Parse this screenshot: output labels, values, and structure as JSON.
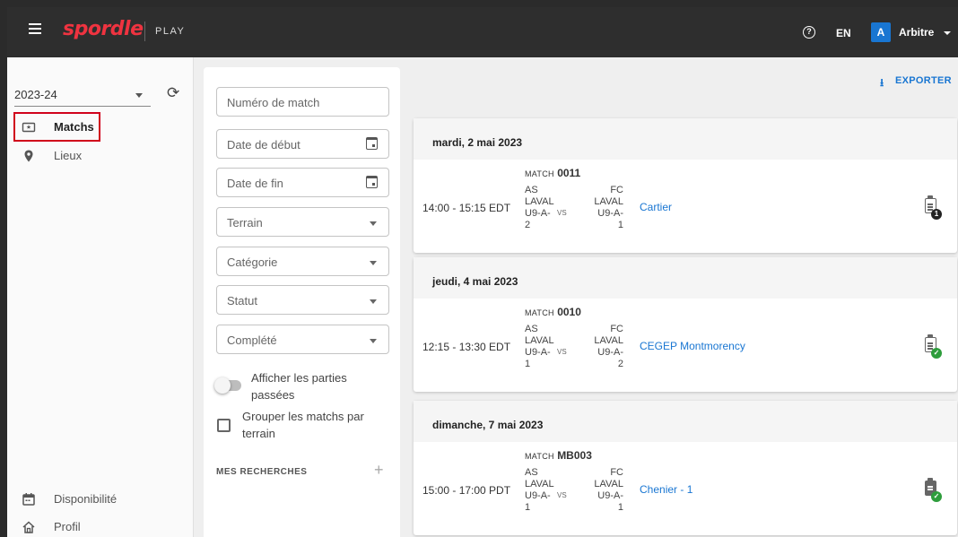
{
  "topbar": {
    "logo": "spordle",
    "product": "PLAY",
    "help_icon": "?",
    "language": "EN",
    "avatar_initial": "A",
    "user_name": "Arbitre",
    "brand_color": "#ef3340"
  },
  "sidebar": {
    "season": "2023-24",
    "items": [
      {
        "label": "Matchs",
        "icon": "ticket-icon",
        "active": true
      },
      {
        "label": "Lieux",
        "icon": "location-pin-icon"
      }
    ],
    "bottom_items": [
      {
        "label": "Disponibilité",
        "icon": "calendar-icon"
      },
      {
        "label": "Profil",
        "icon": "home-icon"
      }
    ]
  },
  "filters": {
    "match_number": "Numéro de match",
    "start_date": "Date de début",
    "end_date": "Date de fin",
    "terrain": "Terrain",
    "category": "Catégorie",
    "status": "Statut",
    "completed": "Complété",
    "show_past": "Afficher les parties passées",
    "group_by_terrain": "Grouper les matchs par terrain",
    "saved_searches": "MES RECHERCHES",
    "add_icon": "+"
  },
  "main": {
    "export_label": "EXPORTER",
    "days": [
      {
        "date": "mardi, 2 mai 2023",
        "match": {
          "time": "14:00 - 15:15 EDT",
          "prefix": "Match",
          "number": "0011",
          "home": [
            "AS",
            "LAVAL",
            "U9-A-",
            "2"
          ],
          "vs": "VS",
          "away": [
            "FC",
            "LAVAL",
            "U9-A-",
            "1"
          ],
          "venue": "Cartier",
          "report_badge": "1"
        }
      },
      {
        "date": "jeudi, 4 mai 2023",
        "match": {
          "time": "12:15 - 13:30 EDT",
          "prefix": "Match",
          "number": "0010",
          "home": [
            "AS",
            "LAVAL",
            "U9-A-",
            "1"
          ],
          "vs": "VS",
          "away": [
            "FC",
            "LAVAL",
            "U9-A-",
            "2"
          ],
          "venue": "CEGEP Montmorency",
          "report_badge": "✓"
        }
      },
      {
        "date": "dimanche, 7 mai 2023",
        "match": {
          "time": "15:00 - 17:00 PDT",
          "prefix": "Match",
          "number": "MB003",
          "home": [
            "AS",
            "LAVAL",
            "U9-A-",
            "1"
          ],
          "vs": "VS",
          "away": [
            "FC",
            "LAVAL",
            "U9-A-",
            "1"
          ],
          "venue": "Chenier - 1",
          "report_badge": "✓"
        }
      }
    ]
  }
}
